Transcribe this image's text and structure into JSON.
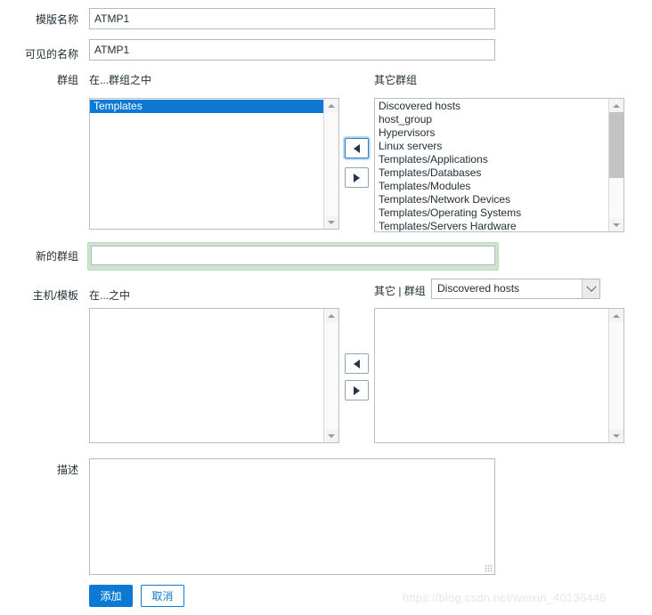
{
  "form": {
    "template_name": {
      "label": "模版名称",
      "value": "ATMP1",
      "placeholder": ""
    },
    "visible_name": {
      "label": "可见的名称",
      "value": "ATMP1",
      "placeholder": ""
    },
    "groups": {
      "label": "群组",
      "in_groups_label": "在...群组之中",
      "other_groups_label": "其它群组",
      "in_groups": [
        {
          "label": "Templates",
          "selected": true
        }
      ],
      "other_groups": [
        {
          "label": "Discovered hosts",
          "selected": false
        },
        {
          "label": "host_group",
          "selected": false
        },
        {
          "label": "Hypervisors",
          "selected": false
        },
        {
          "label": "Linux servers",
          "selected": false
        },
        {
          "label": "Templates/Applications",
          "selected": false
        },
        {
          "label": "Templates/Databases",
          "selected": false
        },
        {
          "label": "Templates/Modules",
          "selected": false
        },
        {
          "label": "Templates/Network Devices",
          "selected": false
        },
        {
          "label": "Templates/Operating Systems",
          "selected": false
        },
        {
          "label": "Templates/Servers Hardware",
          "selected": false
        }
      ],
      "move_left_icon": "triangle-left-icon",
      "move_right_icon": "triangle-right-icon"
    },
    "new_group": {
      "label": "新的群组",
      "value": "",
      "placeholder": "",
      "highlight_color": "#cfe4cf"
    },
    "host_templates": {
      "label": "主机/模板",
      "in_label": "在...之中",
      "other_label": "其它 | 群组",
      "selected_group": "Discovered hosts",
      "group_options": [
        "Discovered hosts"
      ],
      "in_items": [],
      "other_items": [],
      "move_left_icon": "triangle-left-icon",
      "move_right_icon": "triangle-right-icon"
    },
    "description": {
      "label": "描述",
      "value": "",
      "placeholder": ""
    },
    "actions": {
      "submit_label": "添加",
      "cancel_label": "取消",
      "accent_color": "#0c7ad4"
    }
  },
  "watermark": {
    "text": "https://blog.csdn.net/weixin_40136446"
  }
}
